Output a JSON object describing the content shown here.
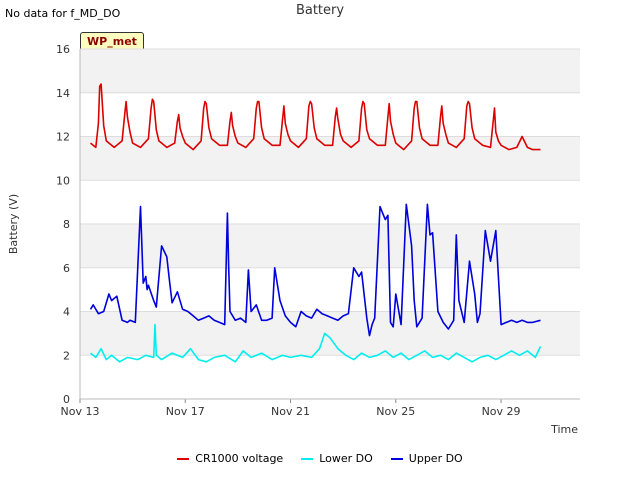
{
  "header": {
    "no_data_text": "No data for f_MD_DO",
    "title": "Battery",
    "badge": "WP_met"
  },
  "chart_data": {
    "type": "line",
    "title": "Battery",
    "xlabel": "Time",
    "ylabel": "Battery (V)",
    "xlim": [
      0,
      19.0
    ],
    "ylim": [
      0,
      16
    ],
    "yticks": [
      0,
      2,
      4,
      6,
      8,
      10,
      12,
      14,
      16
    ],
    "xticks": [
      {
        "pos": 0,
        "label": "Nov 13"
      },
      {
        "pos": 4,
        "label": "Nov 17"
      },
      {
        "pos": 8,
        "label": "Nov 21"
      },
      {
        "pos": 12,
        "label": "Nov 25"
      },
      {
        "pos": 16,
        "label": "Nov 29"
      }
    ],
    "grid": true,
    "legend_position": "bottom",
    "series": [
      {
        "name": "CR1000 voltage",
        "color": "#dd0000",
        "x": [
          0.4,
          0.6,
          0.7,
          0.75,
          0.8,
          0.9,
          1.0,
          1.3,
          1.6,
          1.7,
          1.75,
          1.8,
          1.9,
          2.0,
          2.3,
          2.6,
          2.7,
          2.75,
          2.8,
          2.9,
          3.0,
          3.3,
          3.6,
          3.7,
          3.75,
          3.8,
          3.9,
          4.0,
          4.3,
          4.6,
          4.7,
          4.75,
          4.8,
          4.9,
          5.0,
          5.3,
          5.6,
          5.7,
          5.75,
          5.8,
          5.9,
          6.0,
          6.3,
          6.6,
          6.7,
          6.75,
          6.8,
          6.9,
          7.0,
          7.3,
          7.6,
          7.7,
          7.75,
          7.8,
          7.9,
          8.0,
          8.3,
          8.6,
          8.7,
          8.75,
          8.8,
          8.9,
          9.0,
          9.3,
          9.6,
          9.7,
          9.75,
          9.8,
          9.9,
          10.0,
          10.3,
          10.6,
          10.7,
          10.75,
          10.8,
          10.9,
          11.0,
          11.3,
          11.6,
          11.7,
          11.75,
          11.8,
          11.9,
          12.0,
          12.3,
          12.6,
          12.7,
          12.75,
          12.8,
          12.9,
          13.0,
          13.3,
          13.6,
          13.7,
          13.75,
          13.8,
          13.9,
          14.0,
          14.3,
          14.6,
          14.7,
          14.75,
          14.8,
          14.9,
          15.0,
          15.3,
          15.6,
          15.7,
          15.75,
          15.8,
          15.9,
          16.0,
          16.3,
          16.6,
          16.8,
          17.0,
          17.2,
          17.5
        ],
        "values": [
          11.7,
          11.5,
          12.6,
          14.3,
          14.4,
          12.5,
          11.8,
          11.5,
          11.8,
          13.0,
          13.6,
          12.9,
          12.2,
          11.7,
          11.5,
          11.9,
          13.3,
          13.7,
          13.6,
          12.3,
          11.8,
          11.5,
          11.7,
          12.7,
          13.0,
          12.4,
          12.0,
          11.7,
          11.4,
          11.8,
          13.3,
          13.6,
          13.5,
          12.4,
          11.9,
          11.6,
          11.6,
          12.7,
          13.1,
          12.5,
          12.0,
          11.7,
          11.5,
          11.9,
          13.3,
          13.6,
          13.6,
          12.4,
          11.9,
          11.6,
          11.6,
          12.8,
          13.4,
          12.6,
          12.1,
          11.8,
          11.5,
          11.9,
          13.4,
          13.6,
          13.5,
          12.4,
          11.9,
          11.6,
          11.6,
          12.9,
          13.3,
          12.8,
          12.1,
          11.8,
          11.5,
          11.8,
          13.3,
          13.6,
          13.5,
          12.3,
          11.9,
          11.6,
          11.6,
          12.9,
          13.5,
          12.7,
          12.1,
          11.7,
          11.4,
          11.8,
          13.3,
          13.6,
          13.6,
          12.4,
          11.9,
          11.6,
          11.6,
          12.9,
          13.4,
          12.6,
          12.1,
          11.7,
          11.5,
          11.9,
          13.4,
          13.6,
          13.5,
          12.4,
          11.9,
          11.6,
          11.5,
          12.7,
          13.3,
          12.2,
          11.8,
          11.6,
          11.4,
          11.5,
          12.0,
          11.5,
          11.4,
          11.4
        ]
      },
      {
        "name": "Lower DO",
        "color": "#00eeee",
        "x": [
          0.4,
          0.6,
          0.8,
          1.0,
          1.2,
          1.5,
          1.8,
          2.2,
          2.5,
          2.8,
          2.85,
          2.9,
          3.1,
          3.5,
          3.9,
          4.2,
          4.5,
          4.8,
          5.1,
          5.5,
          5.9,
          6.2,
          6.5,
          6.9,
          7.3,
          7.7,
          8.0,
          8.4,
          8.8,
          9.1,
          9.3,
          9.5,
          9.8,
          10.1,
          10.4,
          10.7,
          11.0,
          11.3,
          11.6,
          11.9,
          12.2,
          12.5,
          12.8,
          13.1,
          13.4,
          13.7,
          14.0,
          14.3,
          14.6,
          14.9,
          15.2,
          15.5,
          15.8,
          16.1,
          16.4,
          16.7,
          17.0,
          17.3,
          17.5
        ],
        "values": [
          2.1,
          1.9,
          2.3,
          1.8,
          2.0,
          1.7,
          1.9,
          1.8,
          2.0,
          1.9,
          3.4,
          2.0,
          1.8,
          2.1,
          1.9,
          2.3,
          1.8,
          1.7,
          1.9,
          2.0,
          1.7,
          2.2,
          1.9,
          2.1,
          1.8,
          2.0,
          1.9,
          2.0,
          1.9,
          2.3,
          3.0,
          2.8,
          2.3,
          2.0,
          1.8,
          2.1,
          1.9,
          2.0,
          2.2,
          1.9,
          2.1,
          1.8,
          2.0,
          2.2,
          1.9,
          2.0,
          1.8,
          2.1,
          1.9,
          1.7,
          1.9,
          2.0,
          1.8,
          2.0,
          2.2,
          2.0,
          2.2,
          1.9,
          2.4
        ]
      },
      {
        "name": "Upper DO",
        "color": "#0000dd",
        "x": [
          0.4,
          0.5,
          0.7,
          0.9,
          1.1,
          1.2,
          1.4,
          1.6,
          1.8,
          1.9,
          2.1,
          2.3,
          2.4,
          2.5,
          2.55,
          2.6,
          2.8,
          2.9,
          3.1,
          3.3,
          3.4,
          3.5,
          3.7,
          3.9,
          4.1,
          4.3,
          4.5,
          4.7,
          4.9,
          5.1,
          5.3,
          5.5,
          5.6,
          5.65,
          5.7,
          5.9,
          6.1,
          6.3,
          6.4,
          6.5,
          6.7,
          6.9,
          7.1,
          7.3,
          7.4,
          7.6,
          7.8,
          8.0,
          8.2,
          8.4,
          8.6,
          8.8,
          9.0,
          9.2,
          9.4,
          9.6,
          9.8,
          10.0,
          10.2,
          10.4,
          10.6,
          10.7,
          10.9,
          11.0,
          11.1,
          11.2,
          11.4,
          11.5,
          11.6,
          11.7,
          11.8,
          11.9,
          12.0,
          12.2,
          12.4,
          12.6,
          12.7,
          12.8,
          13.0,
          13.2,
          13.3,
          13.4,
          13.6,
          13.8,
          14.0,
          14.2,
          14.3,
          14.4,
          14.6,
          14.8,
          15.0,
          15.1,
          15.2,
          15.4,
          15.6,
          15.8,
          16.0,
          16.2,
          16.4,
          16.6,
          16.8,
          17.0,
          17.2,
          17.5
        ],
        "values": [
          4.1,
          4.3,
          3.9,
          4.0,
          4.8,
          4.5,
          4.7,
          3.6,
          3.5,
          3.6,
          3.5,
          8.8,
          5.3,
          5.6,
          5.0,
          5.2,
          4.5,
          4.2,
          7.0,
          6.5,
          5.4,
          4.4,
          4.9,
          4.1,
          4.0,
          3.8,
          3.6,
          3.7,
          3.8,
          3.6,
          3.5,
          3.4,
          8.5,
          6.0,
          4.0,
          3.6,
          3.7,
          3.5,
          5.9,
          4.0,
          4.3,
          3.6,
          3.6,
          3.7,
          6.0,
          4.5,
          3.8,
          3.5,
          3.3,
          4.0,
          3.8,
          3.7,
          4.1,
          3.9,
          3.8,
          3.7,
          3.6,
          3.8,
          3.9,
          6.0,
          5.6,
          5.8,
          3.7,
          2.9,
          3.4,
          3.7,
          8.8,
          8.5,
          8.2,
          8.4,
          3.5,
          3.3,
          4.8,
          3.4,
          8.9,
          7.0,
          4.5,
          3.3,
          3.7,
          8.9,
          7.5,
          7.6,
          4.0,
          3.5,
          3.2,
          3.6,
          7.5,
          4.5,
          3.5,
          6.3,
          4.8,
          3.5,
          3.9,
          7.7,
          6.3,
          7.7,
          3.4,
          3.5,
          3.6,
          3.5,
          3.6,
          3.5,
          3.5,
          3.6
        ]
      }
    ]
  }
}
